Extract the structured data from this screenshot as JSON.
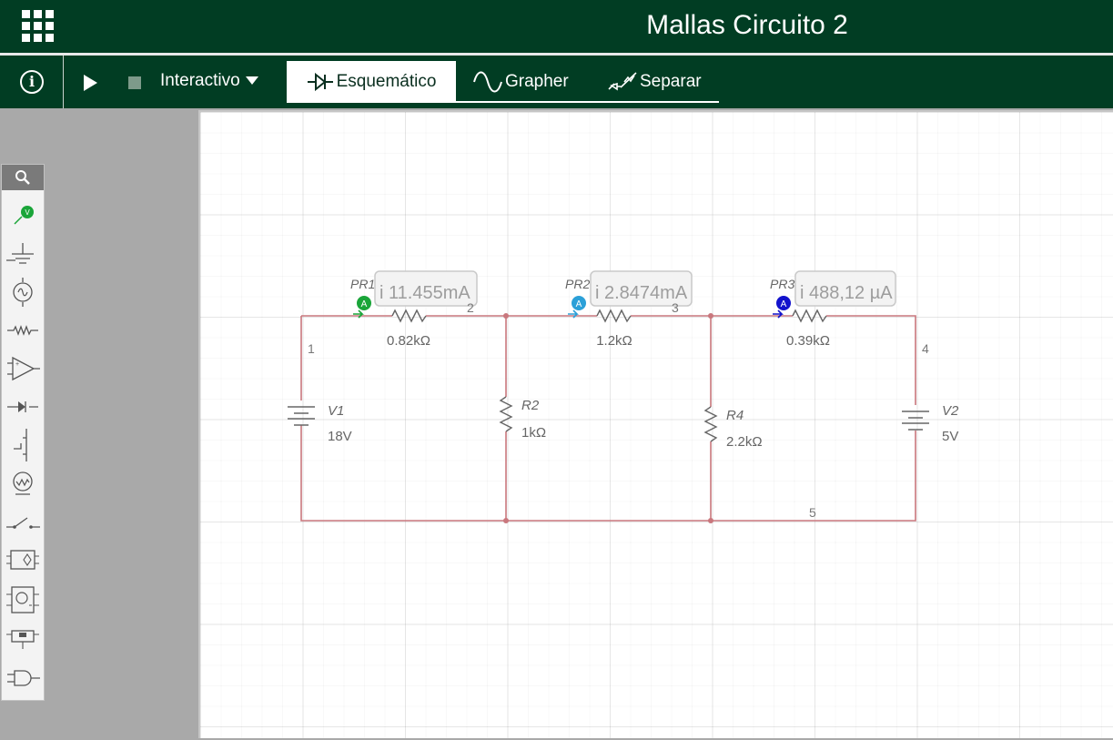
{
  "window": {
    "title": "Mallas Circuito 2"
  },
  "toolbar": {
    "mode_label": "Interactivo",
    "tabs": [
      {
        "label": "Esquemático",
        "active": true
      },
      {
        "label": "Grapher",
        "active": false
      },
      {
        "label": "Separar",
        "active": false
      }
    ]
  },
  "palette": {
    "items": [
      "search-icon",
      "voltage-probe-icon",
      "ground-icon",
      "ac-source-icon",
      "resistor-icon",
      "opamp-icon",
      "diode-icon",
      "transistor-icon",
      "lamp-icon",
      "switch-icon",
      "ic-block-icon",
      "meter-block-icon",
      "relay-block-icon",
      "and-gate-icon"
    ]
  },
  "colors": {
    "header_bg": "#013d23",
    "wire": "#c9777d",
    "probe_pr1": "#1aa539",
    "probe_pr2": "#2ba0d8",
    "probe_pr3": "#1212cc"
  },
  "circuit": {
    "probes": [
      {
        "name": "PR1",
        "reading": "i 11.455mA",
        "badge": "A"
      },
      {
        "name": "PR2",
        "reading": "i 2.8474mA",
        "badge": "A"
      },
      {
        "name": "PR3",
        "reading": "i 488,12 µA",
        "badge": "A"
      }
    ],
    "components": [
      {
        "name": "",
        "value": "0.82kΩ"
      },
      {
        "name": "",
        "value": "1.2kΩ"
      },
      {
        "name": "",
        "value": "0.39kΩ"
      },
      {
        "name": "R2",
        "value": "1kΩ"
      },
      {
        "name": "R4",
        "value": "2.2kΩ"
      },
      {
        "name": "V1",
        "value": "18V"
      },
      {
        "name": "V2",
        "value": "5V"
      }
    ],
    "nodes": [
      "1",
      "2",
      "3",
      "4",
      "5"
    ]
  }
}
